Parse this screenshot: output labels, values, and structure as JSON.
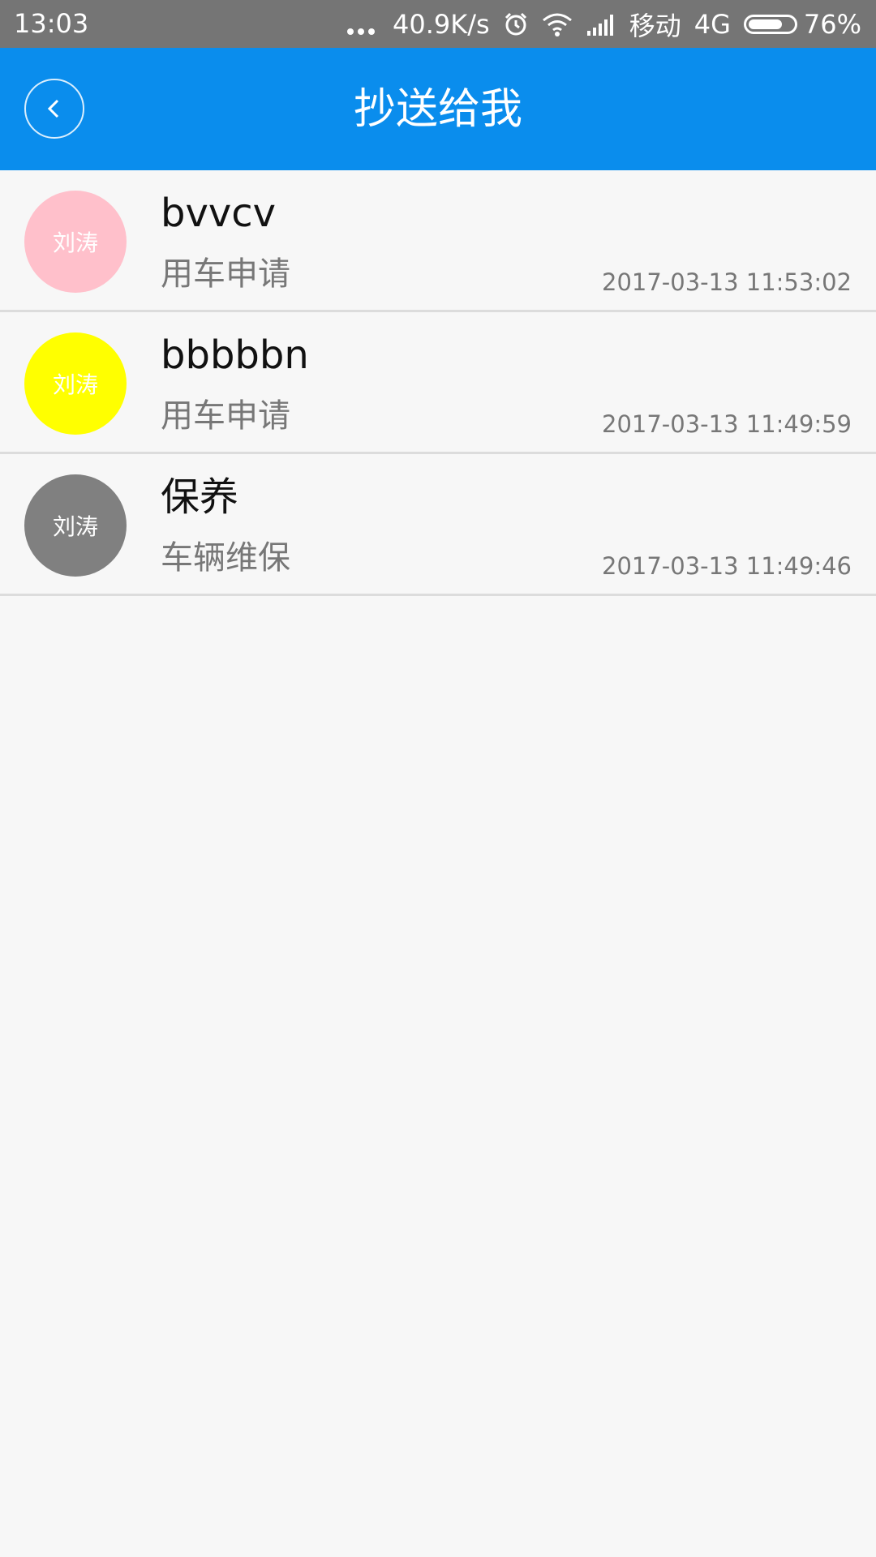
{
  "status_bar": {
    "time": "13:03",
    "speed": "40.9K/s",
    "carrier": "移动",
    "network": "4G",
    "battery": "76%",
    "battery_level": 0.76,
    "icons": [
      "more-dots-icon",
      "alarm-icon",
      "wifi-icon",
      "signal-icon",
      "battery-icon"
    ]
  },
  "header": {
    "title": "抄送给我",
    "back_icon": "chevron-left-icon",
    "color": "#0a8ded"
  },
  "items": [
    {
      "avatar_text": "刘涛",
      "avatar_color": "#ffc0cb",
      "title": "bvvcv",
      "subtitle": "用车申请",
      "time": "2017-03-13 11:53:02"
    },
    {
      "avatar_text": "刘涛",
      "avatar_color": "#ffff00",
      "title": "bbbbbn",
      "subtitle": "用车申请",
      "time": "2017-03-13 11:49:59"
    },
    {
      "avatar_text": "刘涛",
      "avatar_color": "#808080",
      "title": "保养",
      "subtitle": "车辆维保",
      "time": "2017-03-13 11:49:46"
    }
  ]
}
